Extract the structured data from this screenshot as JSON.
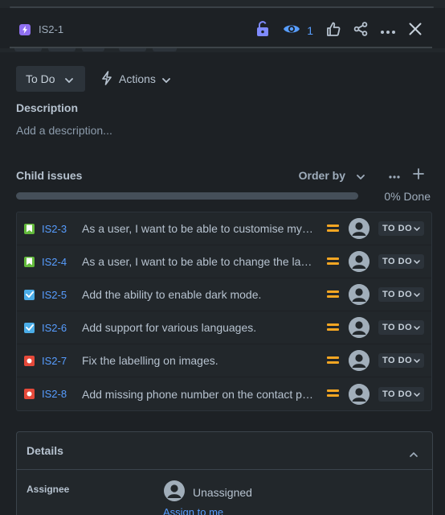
{
  "header": {
    "issue_key": "IS2-1",
    "watch_count": "1",
    "icons": [
      "lightning-icon",
      "lock-open-icon",
      "eye-icon",
      "thumbs-up-icon",
      "share-icon",
      "more-icon",
      "close-icon"
    ]
  },
  "status": {
    "label": "To Do",
    "actions_label": "Actions"
  },
  "description": {
    "title": "Description",
    "placeholder": "Add a description..."
  },
  "child_issues": {
    "title": "Child issues",
    "order_by_label": "Order by",
    "progress_label": "0% Done",
    "progress_fraction": 0,
    "items": [
      {
        "key": "IS2-3",
        "type": "story",
        "summary": "As a user, I want to be able to customise my profile page",
        "status": "TO DO"
      },
      {
        "key": "IS2-4",
        "type": "story",
        "summary": "As a user, I want to be able to change the language of the app",
        "status": "TO DO"
      },
      {
        "key": "IS2-5",
        "type": "task",
        "summary": "Add the ability to enable dark mode.",
        "status": "TO DO"
      },
      {
        "key": "IS2-6",
        "type": "task",
        "summary": "Add support for various languages.",
        "status": "TO DO"
      },
      {
        "key": "IS2-7",
        "type": "bug",
        "summary": "Fix the labelling on images.",
        "status": "TO DO"
      },
      {
        "key": "IS2-8",
        "type": "bug",
        "summary": "Add missing phone number on the contact page",
        "status": "TO DO"
      }
    ]
  },
  "details": {
    "title": "Details",
    "assignee_label": "Assignee",
    "assignee_value": "Unassigned",
    "assign_to_me": "Assign to me"
  },
  "colors": {
    "background": "#1d2125",
    "link": "#579dff",
    "epic": "#8f6ff0",
    "story": "#63ba3c",
    "task": "#4bade8",
    "bug": "#e5493a",
    "priority_medium": "#f5a623"
  }
}
